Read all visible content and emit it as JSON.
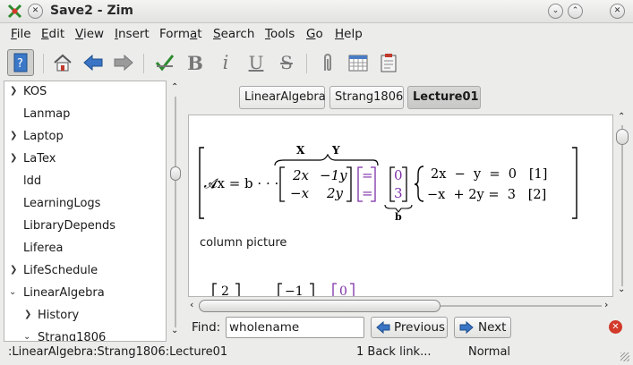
{
  "window": {
    "title": "Save2 - Zim"
  },
  "menu": {
    "file": "File",
    "edit": "Edit",
    "view": "View",
    "insert": "Insert",
    "format": "Format",
    "search": "Search",
    "tools": "Tools",
    "go": "Go",
    "help": "Help"
  },
  "sidebar": {
    "items": [
      {
        "label": "KOS",
        "expander": "collapsed"
      },
      {
        "label": "Lanmap",
        "expander": "none"
      },
      {
        "label": "Laptop",
        "expander": "collapsed"
      },
      {
        "label": "LaTex",
        "expander": "collapsed"
      },
      {
        "label": "ldd",
        "expander": "none"
      },
      {
        "label": "LearningLogs",
        "expander": "none"
      },
      {
        "label": "LibraryDepends",
        "expander": "none"
      },
      {
        "label": "Liferea",
        "expander": "none"
      },
      {
        "label": "LifeSchedule",
        "expander": "collapsed"
      },
      {
        "label": "LinearAlgebra",
        "expander": "expanded"
      },
      {
        "label": "History",
        "expander": "collapsed"
      },
      {
        "label": "Strang1806",
        "expander": "expanded"
      }
    ]
  },
  "pathbar": {
    "tabs": [
      "LinearAlgebra",
      "Strang1806",
      "Lecture01"
    ],
    "active": "Lecture01"
  },
  "editor": {
    "eq_lhs": "𝓐x = b · · ·",
    "brace_x": "X",
    "brace_y": "Y",
    "m11": "2x",
    "m12": "−1y",
    "m21": "−x",
    "m22": "2y",
    "eq_sign": "=",
    "b1": "0",
    "b2": "3",
    "b_label": "b",
    "sys1": "2x  −  y  =  0   [1]",
    "sys2": "−x  + 2y =  3   [2]",
    "column_picture": "column picture",
    "vec1": "2",
    "vec2": "−1",
    "vec3": "0"
  },
  "findbar": {
    "label": "Find:",
    "value": "wholename",
    "previous": "Previous",
    "next": "Next"
  },
  "status": {
    "path": ":LinearAlgebra:Strang1806:Lecture01",
    "backlinks": "1 Back link...",
    "mode": "Normal"
  },
  "colors": {
    "purple": "#7d2fa8",
    "accent": "#2e63b8",
    "close_red": "#d23a2a"
  }
}
